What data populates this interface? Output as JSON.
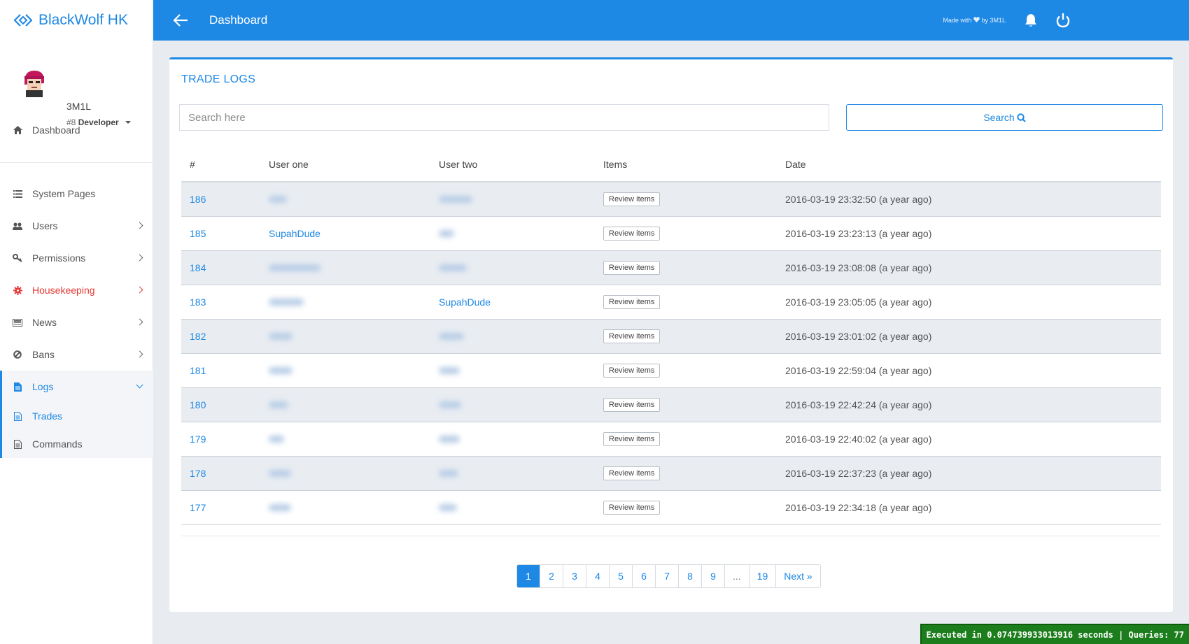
{
  "brand": {
    "name": "BlackWolf HK"
  },
  "profile": {
    "username": "3M1L",
    "rank_id": "#8",
    "rank_name": "Developer"
  },
  "sidebar": {
    "items": [
      {
        "label": "Dashboard",
        "icon": "home-icon"
      },
      {
        "label": "System Pages",
        "icon": "list-icon"
      },
      {
        "label": "Users",
        "icon": "users-icon"
      },
      {
        "label": "Permissions",
        "icon": "key-icon"
      },
      {
        "label": "Housekeeping",
        "icon": "gear-icon"
      },
      {
        "label": "News",
        "icon": "newspaper-icon"
      },
      {
        "label": "Bans",
        "icon": "ban-icon"
      },
      {
        "label": "Logs",
        "icon": "file-icon"
      },
      {
        "label": "Trades",
        "icon": "file-text-icon"
      },
      {
        "label": "Commands",
        "icon": "file-text-icon"
      }
    ]
  },
  "header": {
    "title": "Dashboard",
    "made_with_prefix": "Made with",
    "made_with_suffix": "by 3M1L"
  },
  "card": {
    "title": "TRADE LOGS",
    "search_placeholder": "Search here",
    "search_button": "Search"
  },
  "table": {
    "columns": [
      "#",
      "User one",
      "User two",
      "Items",
      "Date"
    ],
    "review_label": "Review items",
    "rows": [
      {
        "id": "186",
        "user_one": "",
        "user_two": "",
        "date": "2016-03-19 23:32:50 (a year ago)"
      },
      {
        "id": "185",
        "user_one": "SupahDude",
        "user_two": "",
        "date": "2016-03-19 23:23:13 (a year ago)"
      },
      {
        "id": "184",
        "user_one": "",
        "user_two": "",
        "date": "2016-03-19 23:08:08 (a year ago)"
      },
      {
        "id": "183",
        "user_one": "",
        "user_two": "SupahDude",
        "date": "2016-03-19 23:05:05 (a year ago)"
      },
      {
        "id": "182",
        "user_one": "",
        "user_two": "",
        "date": "2016-03-19 23:01:02 (a year ago)"
      },
      {
        "id": "181",
        "user_one": "",
        "user_two": "",
        "date": "2016-03-19 22:59:04 (a year ago)"
      },
      {
        "id": "180",
        "user_one": "",
        "user_two": "",
        "date": "2016-03-19 22:42:24 (a year ago)"
      },
      {
        "id": "179",
        "user_one": "",
        "user_two": "",
        "date": "2016-03-19 22:40:02 (a year ago)"
      },
      {
        "id": "178",
        "user_one": "",
        "user_two": "",
        "date": "2016-03-19 22:37:23 (a year ago)"
      },
      {
        "id": "177",
        "user_one": "",
        "user_two": "",
        "date": "2016-03-19 22:34:18 (a year ago)"
      }
    ]
  },
  "pagination": {
    "pages": [
      "1",
      "2",
      "3",
      "4",
      "5",
      "6",
      "7",
      "8",
      "9",
      "...",
      "19"
    ],
    "active": "1",
    "next_label": "Next »"
  },
  "footer": {
    "exec_text": "Executed in 0.074739933013916 seconds | Queries: 77"
  },
  "colors": {
    "accent": "#1e88e5",
    "danger": "#e53935",
    "exec_bg": "#1b7d1b"
  }
}
